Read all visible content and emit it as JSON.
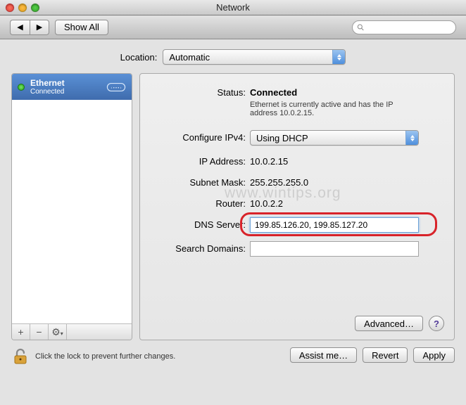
{
  "window": {
    "title": "Network"
  },
  "toolbar": {
    "back": "◀",
    "forward": "▶",
    "show_all": "Show All",
    "search_placeholder": ""
  },
  "location": {
    "label": "Location:",
    "value": "Automatic"
  },
  "sidebar": {
    "items": [
      {
        "name": "Ethernet",
        "status": "Connected",
        "status_color": "#1ea211"
      }
    ],
    "add": "+",
    "remove": "−",
    "action": "⚙"
  },
  "main": {
    "status_label": "Status:",
    "status_value": "Connected",
    "status_desc": "Ethernet is currently active and has the IP address 10.0.2.15.",
    "config_label": "Configure IPv4:",
    "config_value": "Using DHCP",
    "ip_label": "IP Address:",
    "ip_value": "10.0.2.15",
    "mask_label": "Subnet Mask:",
    "mask_value": "255.255.255.0",
    "router_label": "Router:",
    "router_value": "10.0.2.2",
    "dns_label": "DNS Server:",
    "dns_value": "199.85.126.20, 199.85.127.20",
    "domains_label": "Search Domains:",
    "domains_value": "",
    "advanced": "Advanced…",
    "help": "?"
  },
  "footer": {
    "lock_text": "Click the lock to prevent further changes.",
    "assist": "Assist me…",
    "revert": "Revert",
    "apply": "Apply"
  },
  "watermark": "www.wintips.org"
}
